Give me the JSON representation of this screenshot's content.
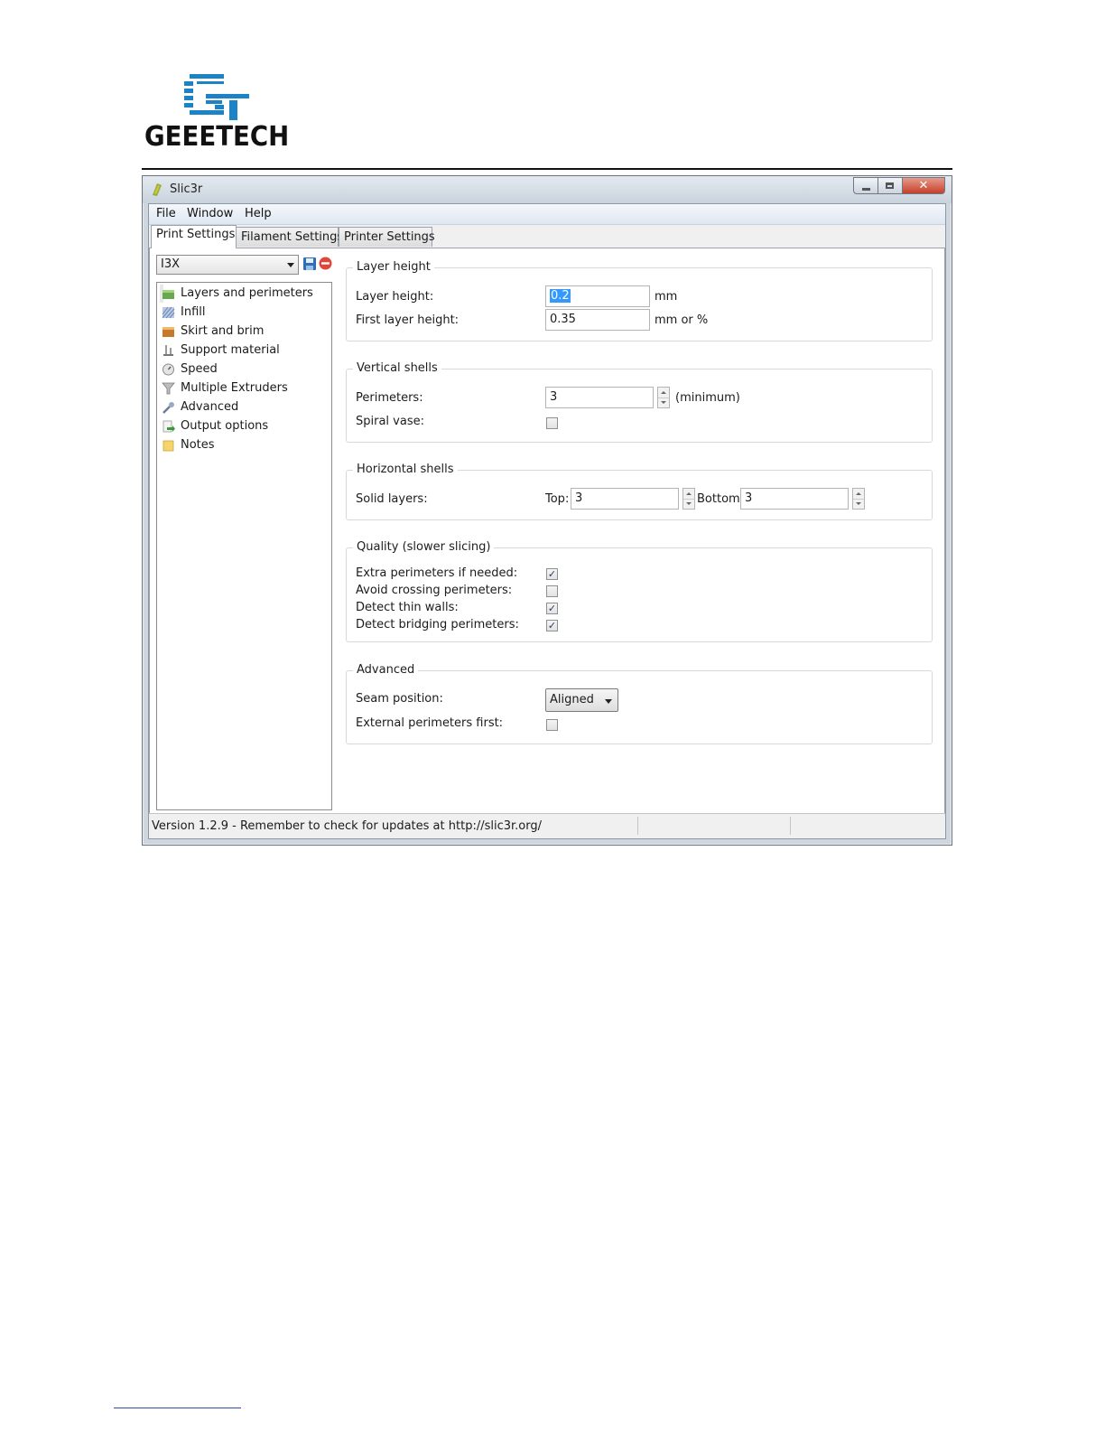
{
  "brand": {
    "logo_text": "GEEETECH"
  },
  "window": {
    "title": "Slic3r",
    "close_glyph": "✕"
  },
  "menu": [
    "File",
    "Window",
    "Help"
  ],
  "tabs": [
    "Print Settings",
    "Filament Settings",
    "Printer Settings"
  ],
  "preset": {
    "value": "I3X"
  },
  "sidebar": {
    "items": [
      {
        "label": "Layers and perimeters",
        "icon": "layers-icon"
      },
      {
        "label": "Infill",
        "icon": "infill-icon"
      },
      {
        "label": "Skirt and brim",
        "icon": "skirt-icon"
      },
      {
        "label": "Support material",
        "icon": "support-icon"
      },
      {
        "label": "Speed",
        "icon": "speed-icon"
      },
      {
        "label": "Multiple Extruders",
        "icon": "funnel-icon"
      },
      {
        "label": "Advanced",
        "icon": "wrench-icon"
      },
      {
        "label": "Output options",
        "icon": "output-icon"
      },
      {
        "label": "Notes",
        "icon": "note-icon"
      }
    ]
  },
  "groups": {
    "layer_height": {
      "title": "Layer height",
      "layer_height_label": "Layer height:",
      "layer_height_value": "0.2",
      "layer_height_unit": "mm",
      "first_layer_label": "First layer height:",
      "first_layer_value": "0.35",
      "first_layer_unit": "mm or %"
    },
    "vertical_shells": {
      "title": "Vertical shells",
      "perimeters_label": "Perimeters:",
      "perimeters_value": "3",
      "perimeters_unit": "(minimum)",
      "spiral_label": "Spiral vase:"
    },
    "horizontal_shells": {
      "title": "Horizontal shells",
      "solid_label": "Solid layers:",
      "top_label": "Top:",
      "top_value": "3",
      "bottom_label": "Bottom:",
      "bottom_value": "3"
    },
    "quality": {
      "title": "Quality (slower slicing)",
      "items": [
        {
          "label": "Extra perimeters if needed:",
          "mark": "✓"
        },
        {
          "label": "Avoid crossing perimeters:",
          "mark": ""
        },
        {
          "label": "Detect thin walls:",
          "mark": "✓"
        },
        {
          "label": "Detect bridging perimeters:",
          "mark": "✓"
        }
      ]
    },
    "advanced": {
      "title": "Advanced",
      "seam_label": "Seam position:",
      "seam_value": "Aligned",
      "external_label": "External perimeters first:"
    }
  },
  "status": {
    "text": "Version 1.2.9 - Remember to check for updates at http://slic3r.org/"
  },
  "colors": {
    "logo_blue": "#1c84c6",
    "close_red": "#c6402a",
    "selection_blue": "#3399ff"
  }
}
